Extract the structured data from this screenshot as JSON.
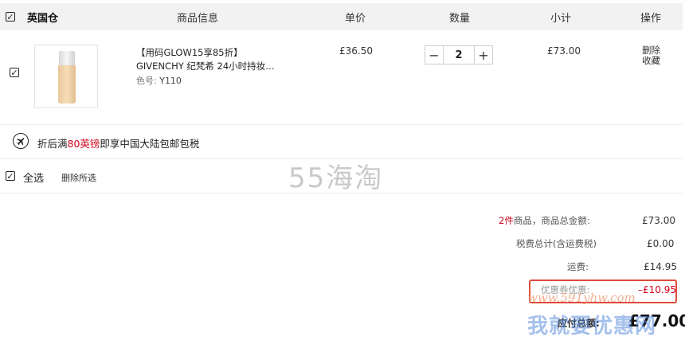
{
  "header": {
    "warehouse": "英国仓",
    "col_info": "商品信息",
    "col_price": "单价",
    "col_qty": "数量",
    "col_subtotal": "小计",
    "col_action": "操作"
  },
  "item": {
    "title_line1": "【用码GLOW15享85折】",
    "title_line2": "GIVENCHY 纪梵希 24小时持妆…",
    "shade_label": "色号:",
    "shade_value": "Y110",
    "unit_price": "£36.50",
    "quantity": "2",
    "subtotal": "£73.00",
    "action_delete": "删除",
    "action_save": "收藏"
  },
  "notice": {
    "prefix": "折后满",
    "highlight": "80英镑",
    "suffix": "即享中国大陆包邮包税"
  },
  "select_bar": {
    "select_all": "全选",
    "delete_selected": "删除所选"
  },
  "watermark": {
    "site": "55海淘",
    "url": "www.591yhw.com",
    "slogan": "我就要优惠网"
  },
  "summary": {
    "count": "2件",
    "count_suffix": "商品，商品总金额:",
    "goods_total": "£73.00",
    "tax_label": "税费总计(含运费税)",
    "tax_value": "£0.00",
    "shipping_label": "运费:",
    "shipping_value": "£14.95",
    "coupon_label": "优惠券优惠:",
    "coupon_value": "–£10.95",
    "total_label": "应付总额:",
    "total_value": "£77.00"
  },
  "colors": {
    "accent_red": "#d0021b",
    "highlight_box": "#e04a3b"
  }
}
